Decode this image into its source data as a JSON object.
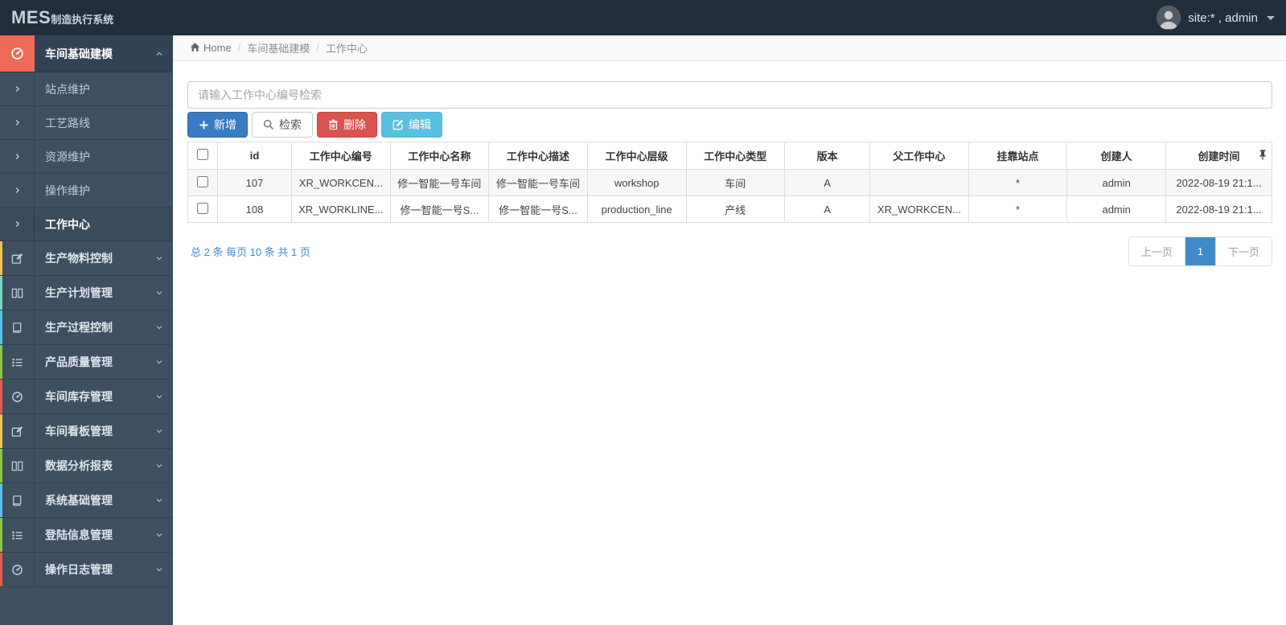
{
  "colors": {
    "topbar_bg": "#232e3d",
    "sidebar_bg": "#3e5060",
    "active_parent_accent": "#ef6a5a",
    "link_blue": "#428bca",
    "btn_primary": "#377bc4",
    "btn_danger": "#d9534f",
    "btn_info": "#5bc0de"
  },
  "topbar": {
    "logo_primary": "MES",
    "logo_secondary": "制造执行系统",
    "user_label": "site:* , admin"
  },
  "sidebar": {
    "parent": {
      "label": "车间基础建模"
    },
    "submenu": [
      {
        "label": "站点维护"
      },
      {
        "label": "工艺路线"
      },
      {
        "label": "资源维护"
      },
      {
        "label": "操作维护"
      },
      {
        "label": "工作中心",
        "active": true
      }
    ],
    "items": [
      {
        "label": "生产物料控制",
        "accent": "#f0c24b"
      },
      {
        "label": "生产计划管理",
        "accent": "#7fd5c0"
      },
      {
        "label": "生产过程控制",
        "accent": "#56c5e8"
      },
      {
        "label": "产品质量管理",
        "accent": "#8dc63f"
      },
      {
        "label": "车间库存管理",
        "accent": "#e9594f"
      },
      {
        "label": "车间看板管理",
        "accent": "#f0c24b"
      },
      {
        "label": "数据分析报表",
        "accent": "#8dc63f"
      },
      {
        "label": "系统基础管理",
        "accent": "#56c5e8"
      },
      {
        "label": "登陆信息管理",
        "accent": "#8dc63f"
      },
      {
        "label": "操作日志管理",
        "accent": "#e9594f"
      }
    ]
  },
  "breadcrumb": {
    "home_label": "Home",
    "sep": "/",
    "level1": "车间基础建模",
    "level2": "工作中心"
  },
  "toolbar": {
    "search_placeholder": "请输入工作中心编号检索",
    "buttons": {
      "add": "新增",
      "search": "检索",
      "delete": "删除",
      "edit": "编辑"
    }
  },
  "table": {
    "columns": [
      "id",
      "工作中心编号",
      "工作中心名称",
      "工作中心描述",
      "工作中心层级",
      "工作中心类型",
      "版本",
      "父工作中心",
      "挂靠站点",
      "创建人",
      "创建时间"
    ],
    "rows": [
      {
        "cells": [
          "107",
          "XR_WORKCEN...",
          "修一智能一号车间",
          "修一智能一号车间",
          "workshop",
          "车间",
          "A",
          "",
          "*",
          "admin",
          "2022-08-19 21:1..."
        ]
      },
      {
        "cells": [
          "108",
          "XR_WORKLINE...",
          "修一智能一号S...",
          "修一智能一号S...",
          "production_line",
          "产线",
          "A",
          "XR_WORKCEN...",
          "*",
          "admin",
          "2022-08-19 21:1..."
        ]
      }
    ]
  },
  "pagination": {
    "summary": "总 2 条  每页 10 条  共 1 页",
    "prev": "上一页",
    "current": "1",
    "next": "下一页"
  }
}
